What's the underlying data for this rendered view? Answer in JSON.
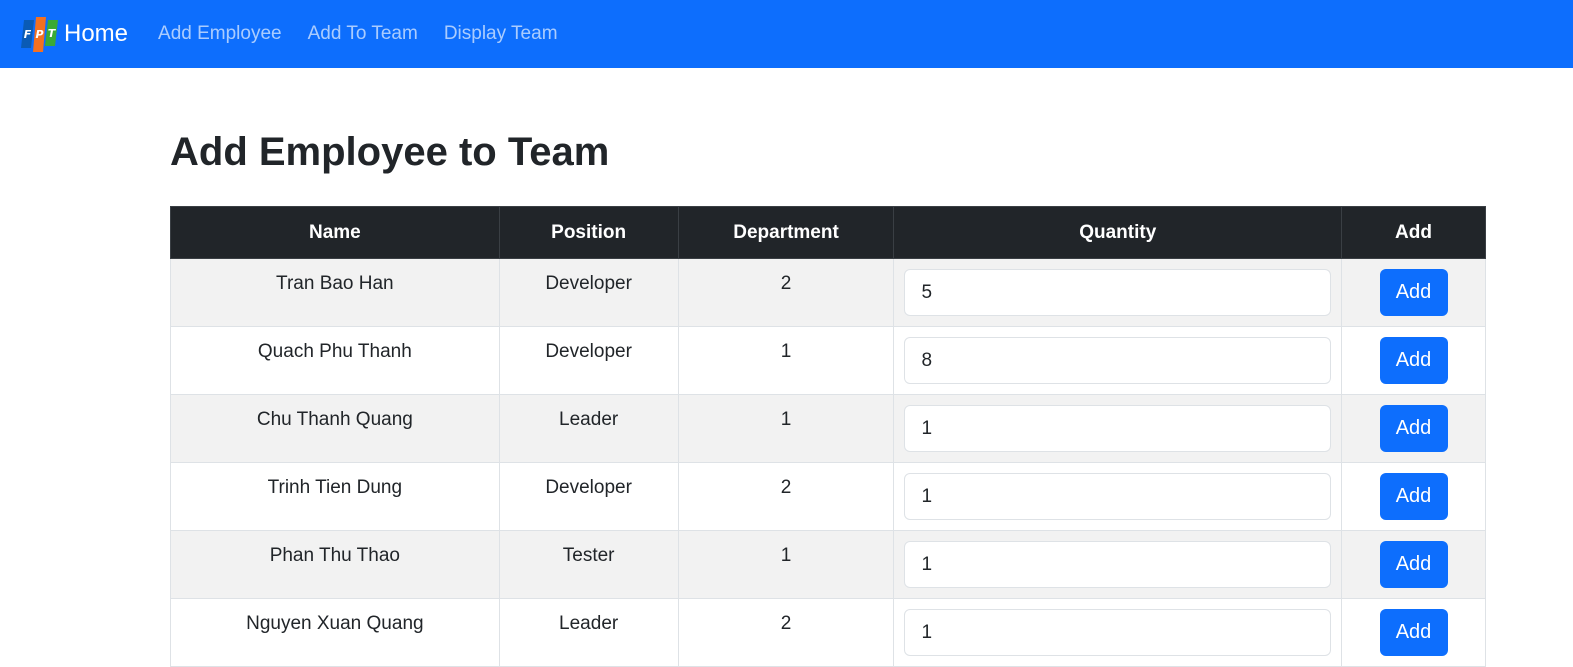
{
  "navbar": {
    "brand": "Home",
    "logo_letters": [
      "F",
      "P",
      "T"
    ],
    "links": [
      "Add Employee",
      "Add To Team",
      "Display Team"
    ]
  },
  "page": {
    "title": "Add Employee to Team"
  },
  "table": {
    "headers": [
      "Name",
      "Position",
      "Department",
      "Quantity",
      "Add"
    ],
    "rows": [
      {
        "name": "Tran Bao Han",
        "position": "Developer",
        "department": "2",
        "quantity": "5",
        "add_label": "Add"
      },
      {
        "name": "Quach Phu Thanh",
        "position": "Developer",
        "department": "1",
        "quantity": "8",
        "add_label": "Add"
      },
      {
        "name": "Chu Thanh Quang",
        "position": "Leader",
        "department": "1",
        "quantity": "1",
        "add_label": "Add"
      },
      {
        "name": "Trinh Tien Dung",
        "position": "Developer",
        "department": "2",
        "quantity": "1",
        "add_label": "Add"
      },
      {
        "name": "Phan Thu Thao",
        "position": "Tester",
        "department": "1",
        "quantity": "1",
        "add_label": "Add"
      },
      {
        "name": "Nguyen Xuan Quang",
        "position": "Leader",
        "department": "2",
        "quantity": "1",
        "add_label": "Add"
      }
    ]
  },
  "colors": {
    "primary": "#0d6efd",
    "header_dark": "#212529",
    "logo_orange": "#f37021",
    "logo_blue": "#0a5bb5",
    "logo_green": "#3aaa35"
  }
}
